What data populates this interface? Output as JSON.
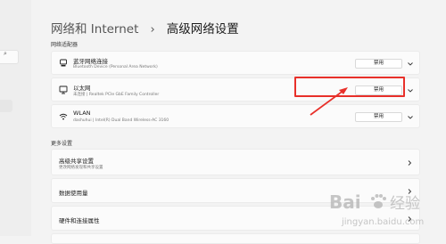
{
  "breadcrumb": {
    "parent": "网络和 Internet",
    "separator": "›",
    "title": "高级网络设置"
  },
  "sections": {
    "adapters": "网络适配器",
    "more": "更多设置"
  },
  "adapters": [
    {
      "name": "蓝牙网络连接",
      "description": "Bluetooth Device (Personal Area Network)",
      "button": "禁用",
      "icon": "bluetooth-network-icon"
    },
    {
      "name": "以太网",
      "description": "未连接 | Realtek PCIe GbE Family Controller",
      "button": "禁用",
      "icon": "ethernet-monitor-icon"
    },
    {
      "name": "WLAN",
      "description": "dashuhui | Intel(R) Dual Band Wireless-AC 3160",
      "button": "禁用",
      "icon": "wifi-icon"
    }
  ],
  "more_settings": [
    {
      "name": "高级共享设置",
      "description": "更改网络发现和共享设置"
    },
    {
      "name": "数据使用量",
      "description": ""
    },
    {
      "name": "硬件和连接属性",
      "description": ""
    }
  ],
  "watermark": {
    "brand": "Bai",
    "brand2": "经验",
    "site": "jingyan.baidu.com"
  },
  "colors": {
    "highlight": "#e8302a",
    "background": "#f3f3f3",
    "card": "#fbfbfb"
  }
}
